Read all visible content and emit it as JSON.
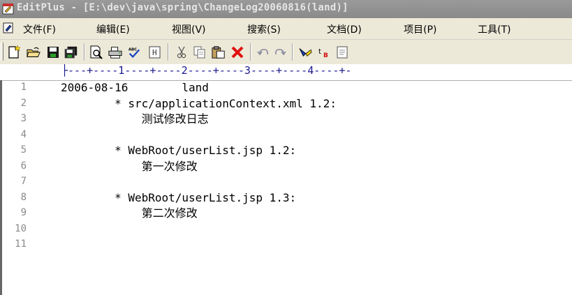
{
  "window": {
    "title": "EditPlus - [E:\\dev\\java\\spring\\ChangeLog20060816(land)]"
  },
  "menu": {
    "items": [
      {
        "label": "文件(F)"
      },
      {
        "label": "编辑(E)"
      },
      {
        "label": "视图(V)"
      },
      {
        "label": "搜索(S)"
      },
      {
        "label": "文档(D)"
      },
      {
        "label": "项目(P)"
      },
      {
        "label": "工具(T)"
      }
    ]
  },
  "toolbar": {
    "buttons": [
      "new-file-icon",
      "open-folder-icon",
      "save-icon",
      "save-all-icon",
      "print-preview-icon",
      "print-icon",
      "spell-check-icon",
      "html-toolbar-icon",
      "cut-icon",
      "copy-icon",
      "paste-icon",
      "delete-icon",
      "undo-icon",
      "redo-icon",
      "highlight-icon",
      "word-wrap-icon",
      "clipboard-icon"
    ]
  },
  "ruler": {
    "text": "├---+----1----+----2----+----3----+----4----+-"
  },
  "editor": {
    "lines": [
      {
        "number": "1",
        "text": "2006-08-16        land"
      },
      {
        "number": "2",
        "text": "        * src/applicationContext.xml 1.2:"
      },
      {
        "number": "3",
        "text": "            测试修改日志"
      },
      {
        "number": "4",
        "text": ""
      },
      {
        "number": "5",
        "text": "        * WebRoot/userList.jsp 1.2:"
      },
      {
        "number": "6",
        "text": "            第一次修改"
      },
      {
        "number": "7",
        "text": ""
      },
      {
        "number": "8",
        "text": "        * WebRoot/userList.jsp 1.3:"
      },
      {
        "number": "9",
        "text": "            第二次修改"
      },
      {
        "number": "10",
        "text": ""
      },
      {
        "number": "11",
        "text": ""
      }
    ]
  },
  "colors": {
    "title_bar": "#8f8f8f",
    "chrome": "#ece9d8",
    "line_number": "#8a8a8a",
    "ruler": "#1a1a90"
  }
}
